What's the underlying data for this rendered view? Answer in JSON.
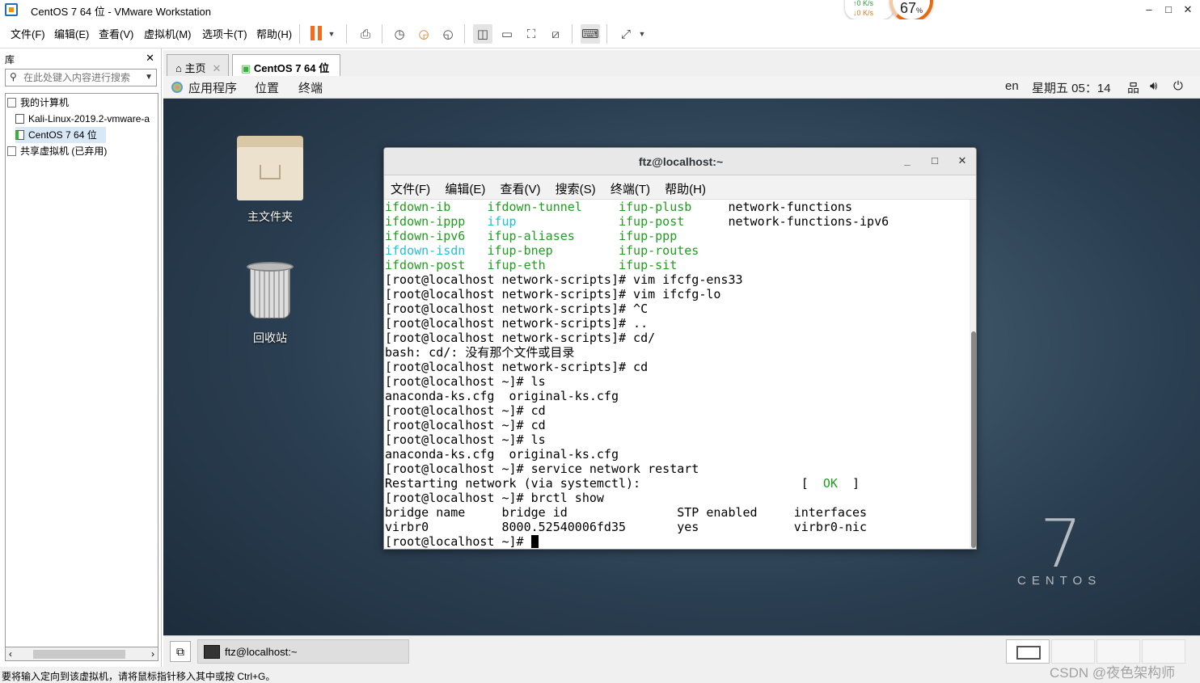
{
  "window": {
    "title": "CentOS 7 64 位 - VMware Workstation"
  },
  "netmon": {
    "up": "↑0  K/s",
    "down": "↓0  K/s"
  },
  "gauge": {
    "value": "67",
    "unit": "%"
  },
  "menubar": {
    "items": [
      "文件(F)",
      "编辑(E)",
      "查看(V)",
      "虚拟机(M)",
      "选项卡(T)",
      "帮助(H)"
    ]
  },
  "library": {
    "title": "库",
    "search_placeholder": "在此处键入内容进行搜索",
    "tree": [
      "我的计算机",
      "Kali-Linux-2019.2-vmware-a",
      "CentOS 7 64 位",
      "共享虚拟机 (已弃用)"
    ]
  },
  "tabs": [
    {
      "label": "主页"
    },
    {
      "label": "CentOS 7 64 位"
    }
  ],
  "gnome": {
    "menus": [
      "应用程序",
      "位置",
      "终端"
    ],
    "lang": "en",
    "clock": "星期五 05：14"
  },
  "desktop": {
    "home_folder": "主文件夹",
    "trash": "回收站",
    "logo_number": "7",
    "logo_word": "CENTOS"
  },
  "terminal": {
    "title": "ftz@localhost:~",
    "menu": [
      "文件(F)",
      "编辑(E)",
      "查看(V)",
      "搜索(S)",
      "终端(T)",
      "帮助(H)"
    ],
    "lines": [
      "[root@localhost network-scripts]# vim ifcfg-ens33",
      "[root@localhost network-scripts]# vim ifcfg-lo",
      "[root@localhost network-scripts]# ^C",
      "[root@localhost network-scripts]# ..",
      "[root@localhost network-scripts]# cd/",
      "bash: cd/: 没有那个文件或目录",
      "[root@localhost network-scripts]# cd",
      "[root@localhost ~]# ls",
      "anaconda-ks.cfg  original-ks.cfg",
      "[root@localhost ~]# cd",
      "[root@localhost ~]# cd",
      "[root@localhost ~]# ls",
      "anaconda-ks.cfg  original-ks.cfg",
      "[root@localhost ~]# service network restart"
    ],
    "restart_line": "Restarting network (via systemctl):",
    "ok": "OK",
    "brctl_cmd": "[root@localhost ~]# brctl show",
    "brctl_header": "bridge name     bridge id               STP enabled     interfaces",
    "brctl_row": "virbr0          8000.52540006fd35       yes             virbr0-nic",
    "prompt": "[root@localhost ~]# "
  },
  "taskbar": {
    "terminal_label": "ftz@localhost:~"
  },
  "statusbar": {
    "text": "要将输入定向到该虚拟机，请将鼠标指针移入其中或按 Ctrl+G。"
  },
  "watermark": "CSDN @夜色架构师"
}
